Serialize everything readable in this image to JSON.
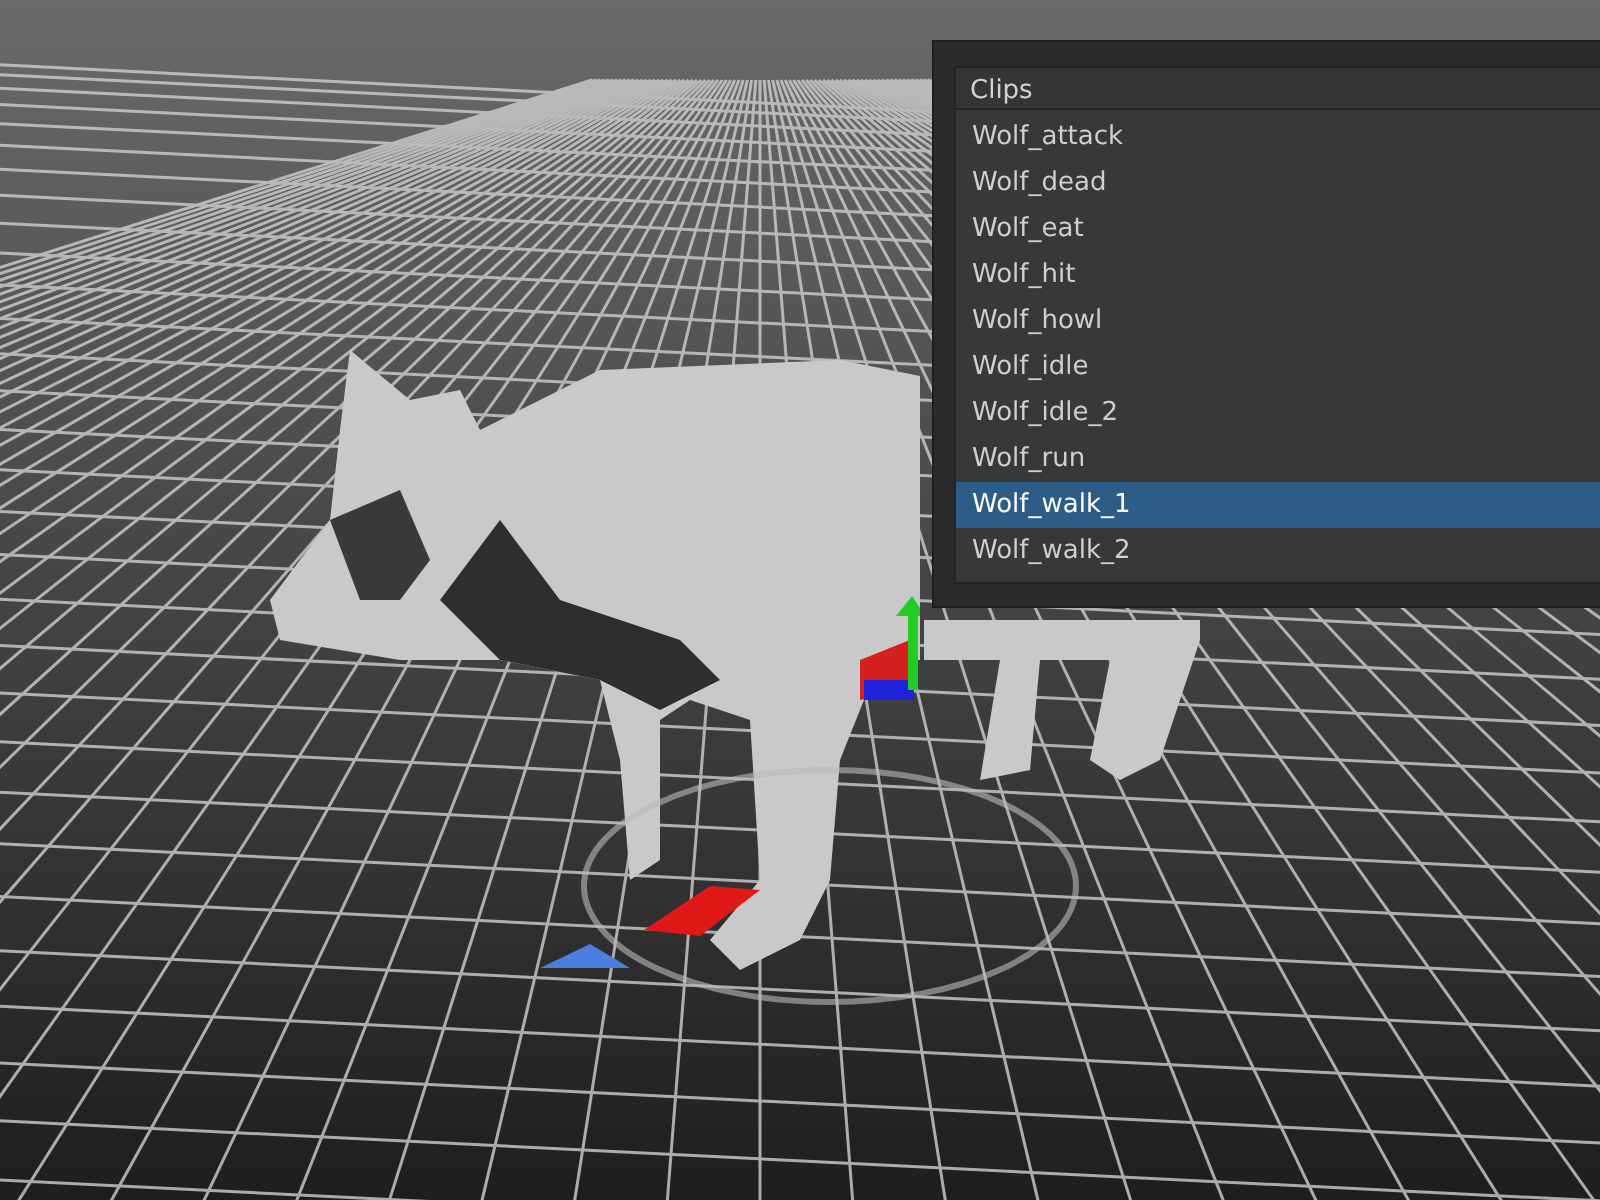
{
  "clips_panel": {
    "title": "Clips",
    "clips": [
      {
        "label": "Wolf_attack",
        "selected": false
      },
      {
        "label": "Wolf_dead",
        "selected": false
      },
      {
        "label": "Wolf_eat",
        "selected": false
      },
      {
        "label": "Wolf_hit",
        "selected": false
      },
      {
        "label": "Wolf_howl",
        "selected": false
      },
      {
        "label": "Wolf_idle",
        "selected": false
      },
      {
        "label": "Wolf_idle_2",
        "selected": false
      },
      {
        "label": "Wolf_run",
        "selected": false
      },
      {
        "label": "Wolf_walk_1",
        "selected": true
      },
      {
        "label": "Wolf_walk_2",
        "selected": false
      }
    ]
  }
}
